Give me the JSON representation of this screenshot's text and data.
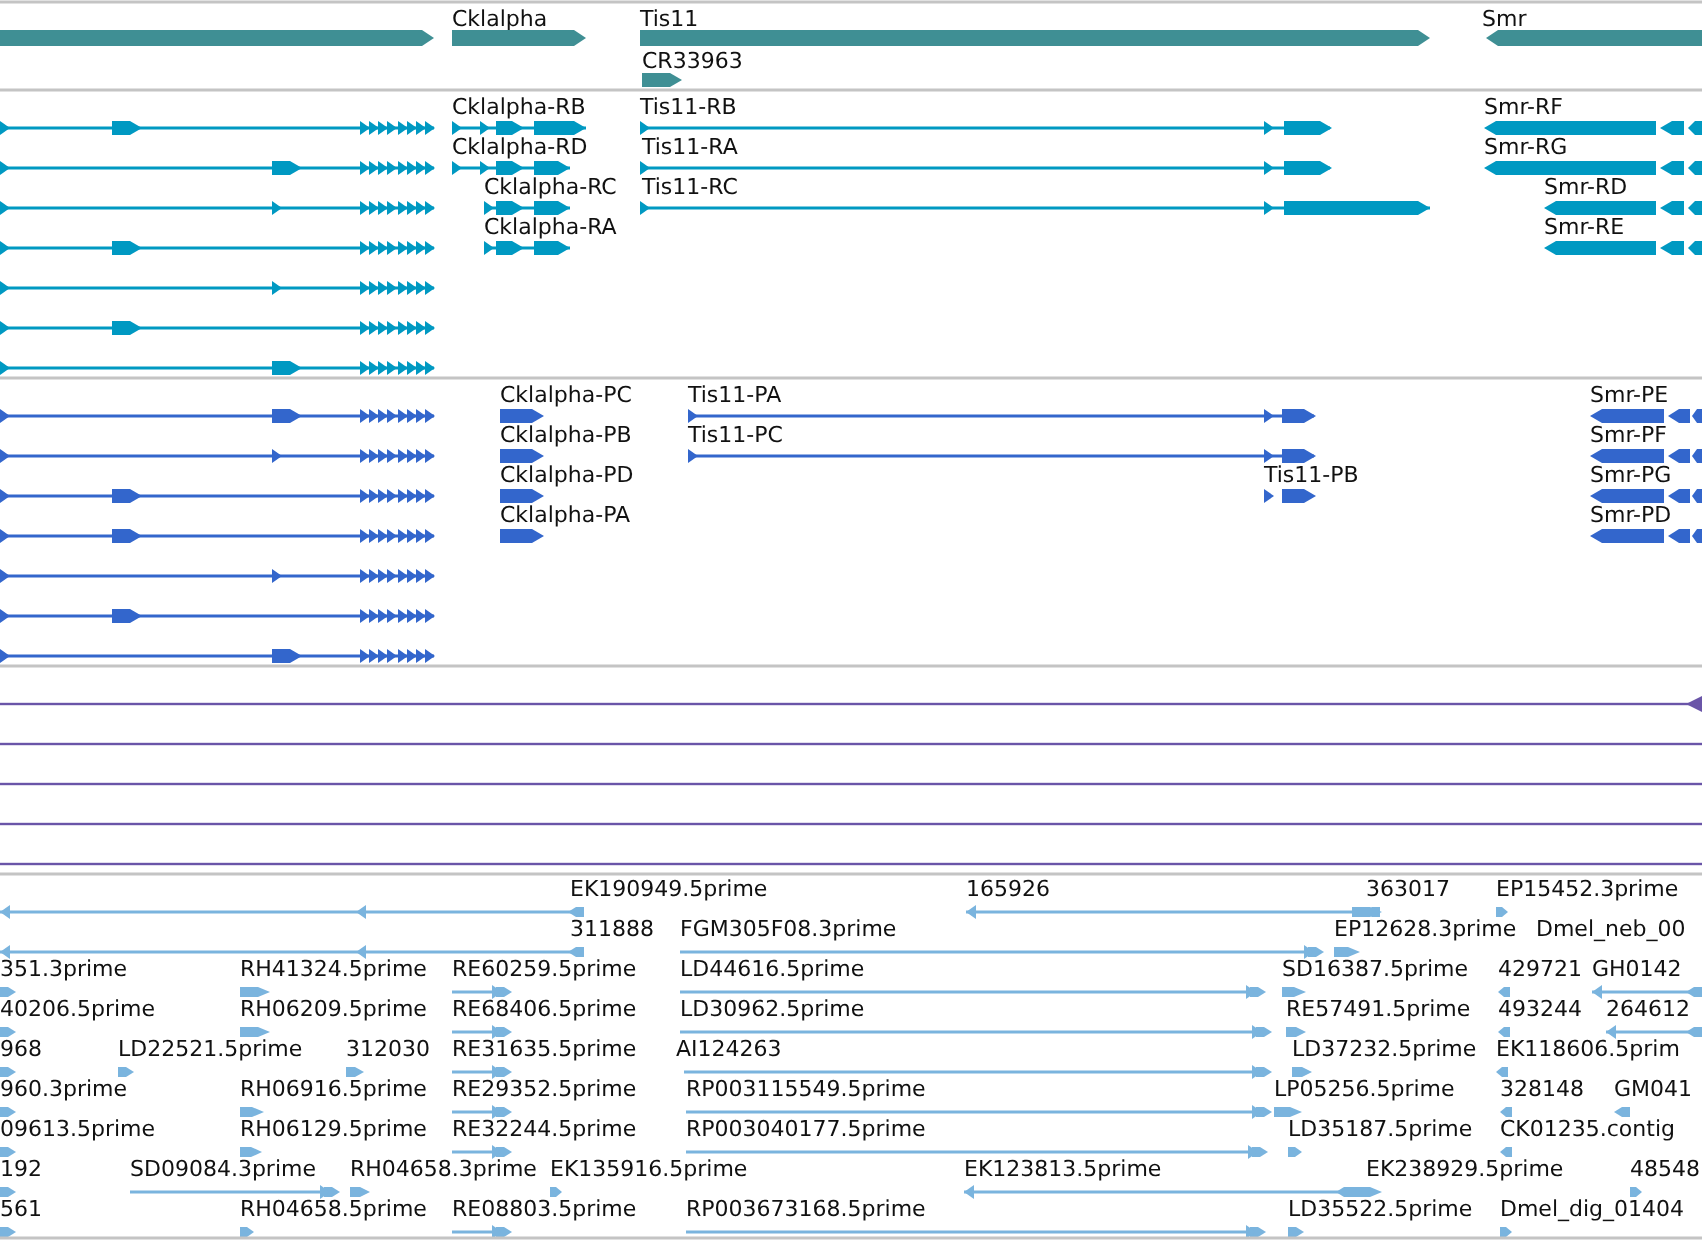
{
  "tracks": [
    {
      "kind": "genes",
      "color": "#3f8f94",
      "features": [
        {
          "label": "Cklalpha"
        },
        {
          "label": "Tis11"
        },
        {
          "label": "CR33963"
        },
        {
          "label": "Smr"
        }
      ]
    },
    {
      "kind": "transcripts",
      "color": "#0099c2",
      "features": [
        {
          "label": "Cklalpha-RB"
        },
        {
          "label": "Cklalpha-RD"
        },
        {
          "label": "Cklalpha-RC"
        },
        {
          "label": "Cklalpha-RA"
        },
        {
          "label": "Tis11-RB"
        },
        {
          "label": "Tis11-RA"
        },
        {
          "label": "Tis11-RC"
        },
        {
          "label": "Smr-RF"
        },
        {
          "label": "Smr-RG"
        },
        {
          "label": "Smr-RD"
        },
        {
          "label": "Smr-RE"
        }
      ]
    },
    {
      "kind": "transcripts",
      "color": "#3366cc",
      "features": [
        {
          "label": "Cklalpha-PC"
        },
        {
          "label": "Cklalpha-PB"
        },
        {
          "label": "Cklalpha-PD"
        },
        {
          "label": "Cklalpha-PA"
        },
        {
          "label": "Tis11-PA"
        },
        {
          "label": "Tis11-PC"
        },
        {
          "label": "Tis11-PB"
        },
        {
          "label": "Smr-PE"
        },
        {
          "label": "Smr-PF"
        },
        {
          "label": "Smr-PG"
        },
        {
          "label": "Smr-PD"
        }
      ]
    },
    {
      "kind": "lines",
      "color": "#6a55a8",
      "rows": [
        {
          "kind": "line"
        },
        {
          "kind": "line"
        },
        {
          "kind": "line"
        },
        {
          "kind": "line"
        },
        {
          "kind": "line"
        }
      ]
    },
    {
      "kind": "alignments",
      "color": "#7ab4de",
      "rows": [
        {
          "features": [
            {
              "label": "EK190949.5prime"
            },
            {
              "label": "165926"
            },
            {
              "label": "363017"
            },
            {
              "label": "EP15452.3prime"
            }
          ]
        },
        {
          "features": [
            {
              "label": "311888"
            },
            {
              "label": "FGM305F08.3prime"
            },
            {
              "label": "EP12628.3prime"
            },
            {
              "label": "Dmel_neb_00"
            }
          ]
        },
        {
          "features": [
            {
              "label": "351.3prime"
            },
            {
              "label": "RH41324.5prime"
            },
            {
              "label": "RE60259.5prime"
            },
            {
              "label": "LD44616.5prime"
            },
            {
              "label": "SD16387.5prime"
            },
            {
              "label": "429721"
            },
            {
              "label": "GH0142"
            }
          ]
        },
        {
          "features": [
            {
              "label": "40206.5prime"
            },
            {
              "label": "RH06209.5prime"
            },
            {
              "label": "RE68406.5prime"
            },
            {
              "label": "LD30962.5prime"
            },
            {
              "label": "RE57491.5prime"
            },
            {
              "label": "493244"
            },
            {
              "label": "264612"
            }
          ]
        },
        {
          "features": [
            {
              "label": "968"
            },
            {
              "label": "LD22521.5prime"
            },
            {
              "label": "312030"
            },
            {
              "label": "RE31635.5prime"
            },
            {
              "label": "AI124263"
            },
            {
              "label": "LD37232.5prime"
            },
            {
              "label": "EK118606.5prim"
            }
          ]
        },
        {
          "features": [
            {
              "label": "960.3prime"
            },
            {
              "label": "RH06916.5prime"
            },
            {
              "label": "RE29352.5prime"
            },
            {
              "label": "RP003115549.5prime"
            },
            {
              "label": "LP05256.5prime"
            },
            {
              "label": "328148"
            },
            {
              "label": "GM041"
            }
          ]
        },
        {
          "features": [
            {
              "label": "09613.5prime"
            },
            {
              "label": "RH06129.5prime"
            },
            {
              "label": "RE32244.5prime"
            },
            {
              "label": "RP003040177.5prime"
            },
            {
              "label": "LD35187.5prime"
            },
            {
              "label": "CK01235.contig"
            }
          ]
        },
        {
          "features": [
            {
              "label": "192"
            },
            {
              "label": "SD09084.3prime"
            },
            {
              "label": "RH04658.3prime"
            },
            {
              "label": "EK135916.5prime"
            },
            {
              "label": "EK123813.5prime"
            },
            {
              "label": "EK238929.5prime"
            },
            {
              "label": "48548"
            }
          ]
        },
        {
          "features": [
            {
              "label": "561"
            },
            {
              "label": "RH04658.5prime"
            },
            {
              "label": "RE08803.5prime"
            },
            {
              "label": "RP003673168.5prime"
            },
            {
              "label": "LD35522.5prime"
            },
            {
              "label": "Dmel_dig_01404"
            }
          ]
        }
      ]
    }
  ]
}
